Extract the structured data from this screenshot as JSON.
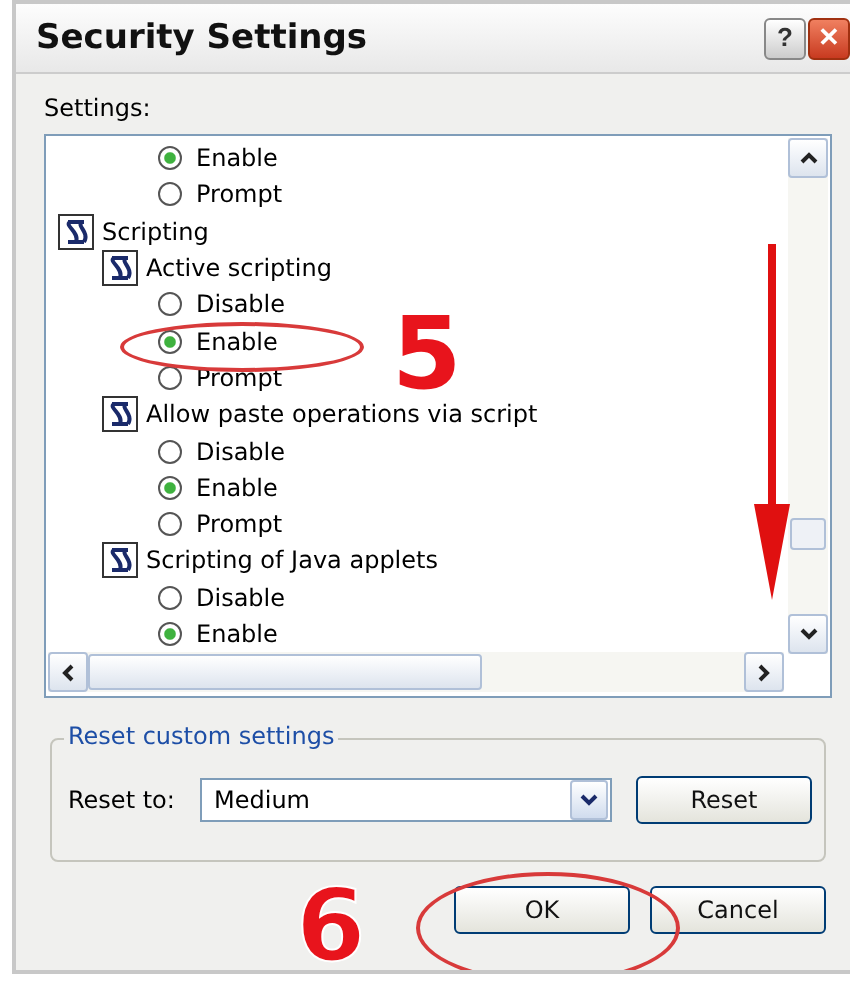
{
  "window": {
    "title": "Security Settings",
    "title_buttons": [
      {
        "kind": "help",
        "label": "?"
      },
      {
        "kind": "close",
        "label": "✕"
      }
    ]
  },
  "settings": {
    "label": "Settings:",
    "items": [
      {
        "kind": "option",
        "label": "Enable",
        "selected": true
      },
      {
        "kind": "option",
        "label": "Prompt",
        "selected": false
      },
      {
        "kind": "group",
        "label": "Scripting",
        "children": [
          {
            "kind": "group",
            "label": "Active scripting",
            "children": [
              {
                "kind": "option",
                "label": "Disable",
                "selected": false
              },
              {
                "kind": "option",
                "label": "Enable",
                "selected": true
              },
              {
                "kind": "option",
                "label": "Prompt",
                "selected": false
              }
            ]
          },
          {
            "kind": "group",
            "label": "Allow paste operations via script",
            "children": [
              {
                "kind": "option",
                "label": "Disable",
                "selected": false
              },
              {
                "kind": "option",
                "label": "Enable",
                "selected": true
              },
              {
                "kind": "option",
                "label": "Prompt",
                "selected": false
              }
            ]
          },
          {
            "kind": "group",
            "label": "Scripting of Java applets",
            "children": [
              {
                "kind": "option",
                "label": "Disable",
                "selected": false
              },
              {
                "kind": "option",
                "label": "Enable",
                "selected": true
              }
            ]
          }
        ]
      }
    ]
  },
  "reset": {
    "legend": "Reset custom settings",
    "label": "Reset to:",
    "value": "Medium",
    "button": "Reset"
  },
  "buttons": [
    {
      "label": "OK"
    },
    {
      "label": "Cancel"
    }
  ],
  "annotations": [
    {
      "kind": "step",
      "label": "5"
    },
    {
      "kind": "step",
      "label": "6"
    }
  ]
}
